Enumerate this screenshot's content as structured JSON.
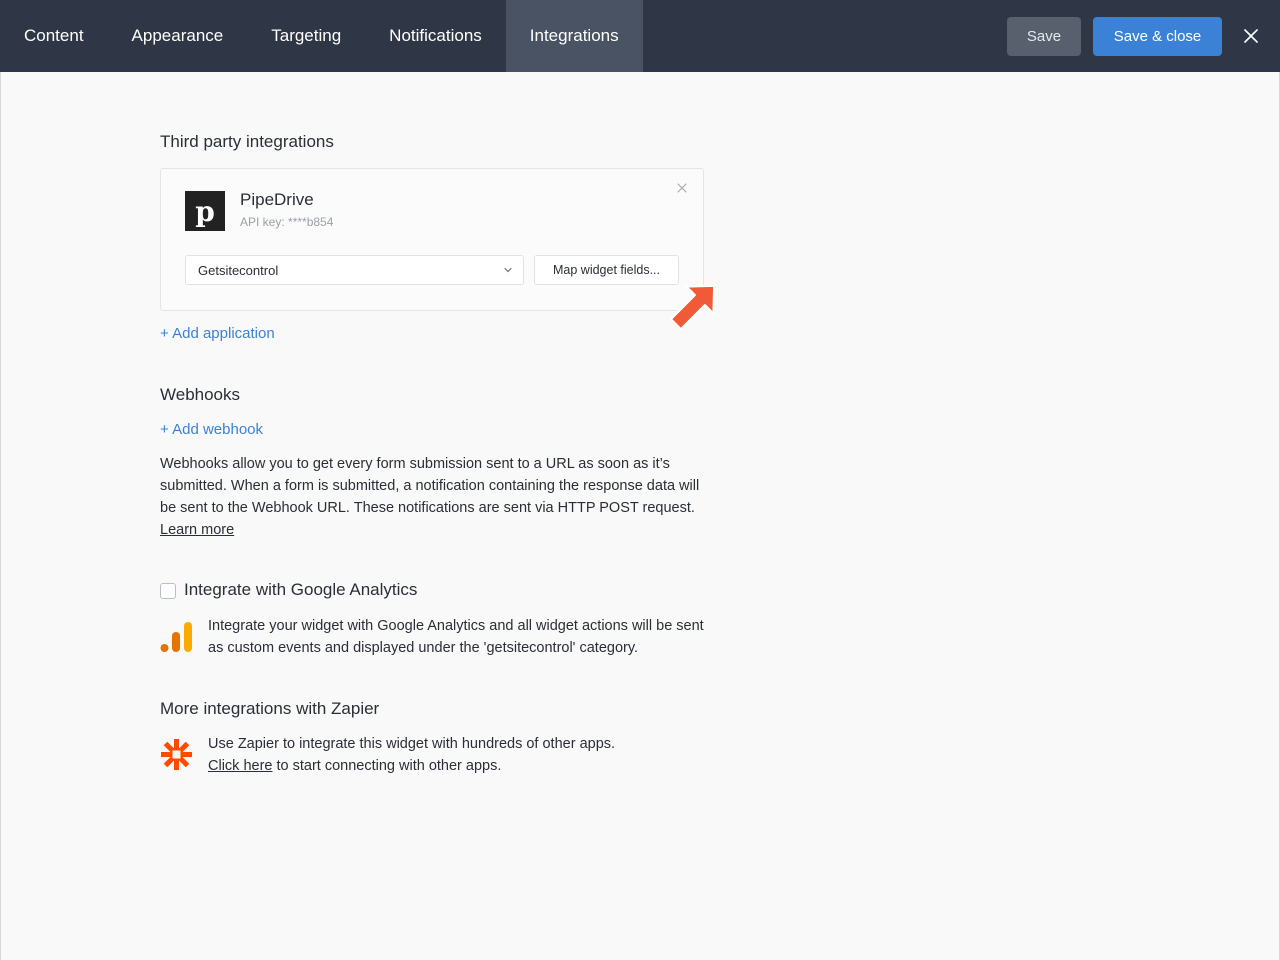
{
  "tabs": [
    {
      "label": "Content"
    },
    {
      "label": "Appearance"
    },
    {
      "label": "Targeting"
    },
    {
      "label": "Notifications"
    },
    {
      "label": "Integrations"
    }
  ],
  "active_tab": "Integrations",
  "actions": {
    "save_label": "Save",
    "save_close_label": "Save & close",
    "close_icon": "close-icon"
  },
  "third_party": {
    "title": "Third party integrations",
    "app": {
      "name": "PipeDrive",
      "logo_letter": "p",
      "api_key": "API key: ****b854",
      "selected_option": "Getsitecontrol",
      "map_button_label": "Map widget fields..."
    },
    "add_application": "+ Add application"
  },
  "webhooks": {
    "title": "Webhooks",
    "add_label": "+ Add webhook",
    "description": "Webhooks allow you to get every form submission sent to a URL as soon as it’s submitted. When a form is submitted, a notification containing the response data will be sent to the Webhook URL. These notifications are sent via HTTP POST request.",
    "learn_more": "Learn more"
  },
  "google_analytics": {
    "checkbox_label": "Integrate with Google Analytics",
    "checked": false,
    "description": "Integrate your widget with Google Analytics and all widget actions will be sent as custom events and displayed under the 'getsitecontrol' category."
  },
  "zapier": {
    "title": "More integrations with Zapier",
    "line1": "Use Zapier to integrate this widget with hundreds of other apps.",
    "click_here": "Click here",
    "line2_rest": " to start connecting with other apps."
  },
  "colors": {
    "topbar": "#2f3747",
    "active_tab": "#4a5364",
    "primary": "#3b82d6",
    "arrow": "#f05a36",
    "zapier": "#ff4a00",
    "ga_orange": "#f9ab00",
    "ga_dark_orange": "#e37400"
  }
}
